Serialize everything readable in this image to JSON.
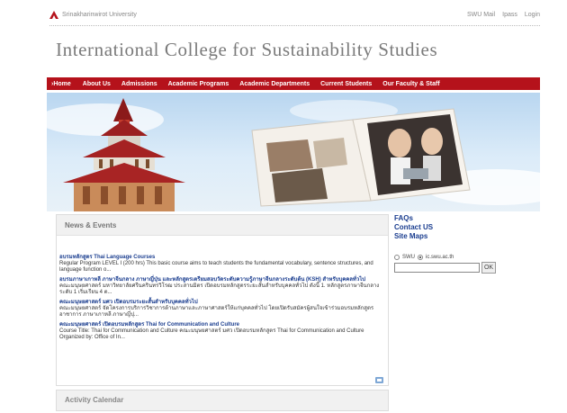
{
  "top": {
    "university": "Srinakharinwirot University",
    "links": [
      "SWU Mail",
      "Ipass",
      "Login"
    ]
  },
  "site_title": "International College for Sustainability Studies",
  "nav": {
    "items": [
      "Home",
      "About Us",
      "Admissions",
      "Academic Programs",
      "Academic Departments",
      "Current Students",
      "Our Faculty & Staff"
    ]
  },
  "news": {
    "heading": "News & Events",
    "items": [
      {
        "title": "อบรมหลักสูตร Thai Language Courses",
        "body": "Regular Program LEVEL I (200 hrs) This basic course aims to teach students the fundamental vocabulary, sentence structures, and language function o..."
      },
      {
        "title": "อบรมภาษาเกาหลี ภาษาจีนกลาง ภาษาญี่ปุ่น และหลักสูตรเตรียมสอบวัดระดับความรู้ภาษาจีนกลางระดับต้น (KSH) สำหรับบุคคลทั่วไป",
        "body": "คณะมนุษยศาสตร์ มหาวิทยาลัยศรีนครินทรวิโรฒ ประสานมิตร เปิดอบรมหลักสูตรระยะสั้นสำหรับบุคคลทั่วไป ดังนี้ 1. หลักสูตรภาษาจีนกลาง ระดับ 1 เริ่มเรียน 4 ต..."
      },
      {
        "title": "คณะมนุษยศาสตร์ มศว เปิดอบรมระยะสั้นสำหรับบุคคลทั่วไป",
        "body": "คณะมนุษยศาสตร์ จัดโครงการบริการวิชาการด้านภาษาและภาษาศาสตร์ให้แก่บุคคลทั่วไป โดยเปิดรับสมัครผู้สนใจเข้าร่วมอบรมหลักสูตรอาชาการ ภาษาเกาหลี ภาษาญี่ปุ..."
      },
      {
        "title": "คณะมนุษยศาสตร์ เปิดอบรมหลักสูตร Thai for Communication and Culture",
        "body": "Course Title: Thai for Communication and Culture คณะมนุษยศาสตร์ มศว เปิดอบรมหลักสูตร Thai for Communication and Culture Organized by: Office of In..."
      }
    ]
  },
  "activity": {
    "heading": "Activity Calendar"
  },
  "sidebar": {
    "links": [
      "FAQs",
      "Contact US",
      "Site Maps"
    ]
  },
  "search": {
    "options": [
      "SWU",
      "ic.swu.ac.th"
    ],
    "selected": "ic.swu.ac.th",
    "button": "OK",
    "value": ""
  },
  "colors": {
    "nav_bg": "#b5121b",
    "link": "#1a3d8f",
    "title": "#7a7a7a"
  },
  "icons": {
    "logo": "swu-logo-icon",
    "feed": "rss-icon"
  }
}
